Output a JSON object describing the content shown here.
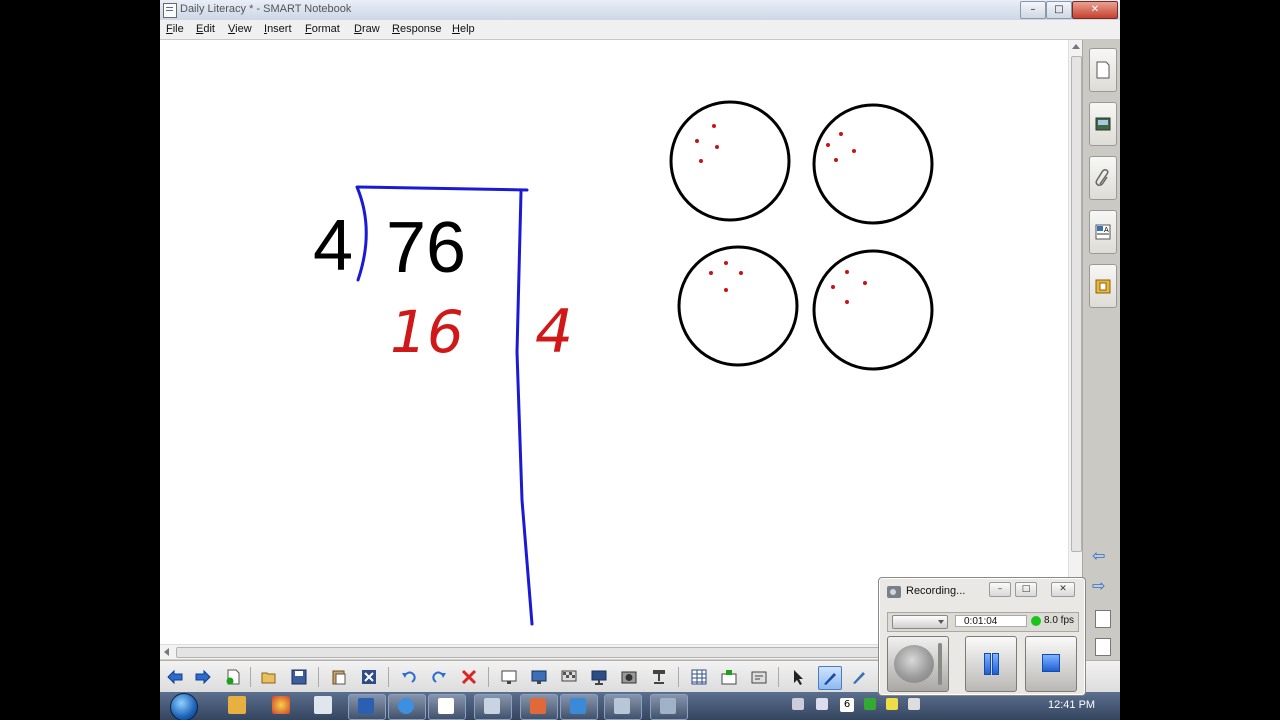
{
  "window": {
    "title": "Daily Literacy * - SMART Notebook",
    "min_label": "–",
    "max_label": "□",
    "close_label": "✕"
  },
  "menu": {
    "items": [
      "File",
      "Edit",
      "View",
      "Insert",
      "Format",
      "Draw",
      "Response",
      "Help"
    ]
  },
  "canvas": {
    "divisor": "4",
    "dividend": "76",
    "product": "16",
    "quotient_part": "4",
    "circles": [
      {
        "dots": 4
      },
      {
        "dots": 4
      },
      {
        "dots": 4
      },
      {
        "dots": 4
      }
    ],
    "colors": {
      "ink_black": "#000000",
      "ink_blue": "#1a1ad6",
      "ink_red": "#d01818",
      "dot_red": "#cc1111"
    }
  },
  "sidebar": {
    "tabs": [
      "page-sorter-icon",
      "gallery-icon",
      "attachments-icon",
      "properties-icon",
      "addons-icon"
    ],
    "nav": [
      "previous-page-icon",
      "next-page-icon"
    ]
  },
  "toolbar": {
    "tools": [
      "back-icon",
      "forward-icon",
      "add-page-icon",
      "open-icon",
      "save-icon",
      "paste-icon",
      "delete-page-icon",
      "undo-icon",
      "redo-icon",
      "delete-icon",
      "screen-shade-icon",
      "full-screen-icon",
      "transparent-background-icon",
      "display-icon",
      "screen-capture-icon",
      "document-camera-icon",
      "table-icon",
      "measure-icon",
      "response-icon",
      "select-icon",
      "pen-icon",
      "creative-pen-icon"
    ]
  },
  "recording": {
    "title": "Recording...",
    "time": "0:01:04",
    "fps": "8.0 fps",
    "status_color": "#1bc41b"
  },
  "taskbar": {
    "clock": "12:41 PM",
    "badge": "6"
  }
}
